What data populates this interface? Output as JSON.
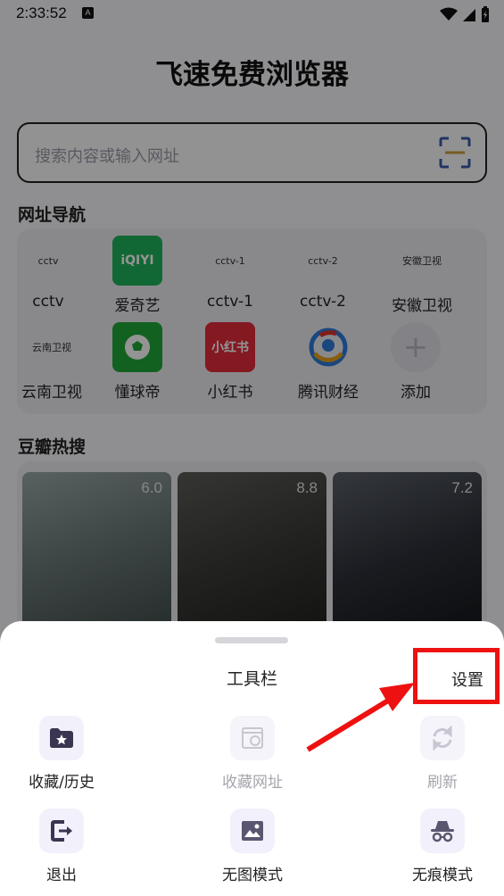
{
  "status_bar": {
    "time": "2:33:52",
    "notification_glyph": "A"
  },
  "app": {
    "title": "飞速免费浏览器",
    "search": {
      "placeholder": "搜索内容或输入网址"
    },
    "nav_section_title": "网址导航",
    "nav_items": [
      {
        "label": "cctv",
        "icon_text": "cctv"
      },
      {
        "label": "爱奇艺",
        "icon_text": "iQIYI"
      },
      {
        "label": "cctv-1",
        "icon_text": "cctv-1"
      },
      {
        "label": "cctv-2",
        "icon_text": "cctv-2"
      },
      {
        "label": "安徽卫视",
        "icon_text": "安徽卫视"
      },
      {
        "label": "云南卫视",
        "icon_text": "云南卫视"
      },
      {
        "label": "懂球帝",
        "icon_text": "懂球帝"
      },
      {
        "label": "小红书",
        "icon_text": "小红书"
      },
      {
        "label": "腾讯财经",
        "icon_text": ""
      },
      {
        "label": "添加",
        "icon_text": "+"
      }
    ],
    "hot_section_title": "豆瓣热搜",
    "hot_items": [
      {
        "score": "6.0"
      },
      {
        "score": "8.8"
      },
      {
        "score": "7.2"
      }
    ]
  },
  "toolbar_sheet": {
    "title": "工具栏",
    "settings_label": "设置",
    "tools": [
      {
        "label": "收藏/历史",
        "icon": "folder-star-icon",
        "enabled": true
      },
      {
        "label": "收藏网址",
        "icon": "bookmark-page-icon",
        "enabled": false
      },
      {
        "label": "刷新",
        "icon": "refresh-icon",
        "enabled": false
      },
      {
        "label": "退出",
        "icon": "exit-icon",
        "enabled": true
      },
      {
        "label": "无图模式",
        "icon": "image-icon",
        "enabled": true
      },
      {
        "label": "无痕模式",
        "icon": "incognito-icon",
        "enabled": true
      }
    ]
  },
  "colors": {
    "highlight": "#ee1111",
    "icon_purple": "#3a3550",
    "icon_bg": "#f2f0fa",
    "disabled_text": "#a5a5ad"
  }
}
